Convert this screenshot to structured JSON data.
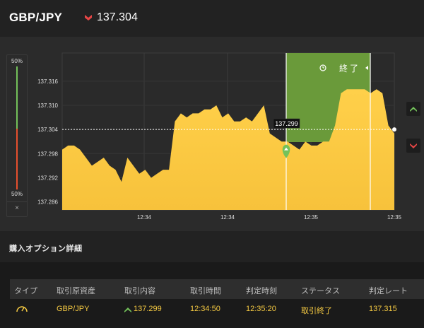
{
  "header": {
    "pair": "GBP/JPY",
    "price": "137.304",
    "trend_icon": "down-arrow-icon",
    "down_color": "#e84646",
    "up_color": "#74c25a",
    "accent_yellow": "#f3c842"
  },
  "sentiment_bar": {
    "top_label": "50%",
    "bottom_label": "50%",
    "up_percent": 50,
    "down_percent": 50,
    "close_label": "×"
  },
  "chart": {
    "overlay_label": "終了",
    "overlay_icon": "clock-icon",
    "current_price_tag": "137.299",
    "entry_marker_icon": "up-arrow-marker-icon",
    "side_buttons": [
      "up-arrow-icon",
      "down-arrow-icon"
    ]
  },
  "chart_data": {
    "type": "area",
    "y_ticks": [
      "137.316",
      "137.310",
      "137.304",
      "137.298",
      "137.292",
      "137.286"
    ],
    "x_ticks": [
      "12:34",
      "12:34",
      "12:35",
      "12:35"
    ],
    "current_price": 137.304,
    "entry_price": 137.299,
    "ylim": [
      137.284,
      137.323
    ],
    "series": [
      {
        "values": [
          137.299,
          137.3,
          137.3,
          137.299,
          137.297,
          137.295,
          137.296,
          137.297,
          137.295,
          137.294,
          137.291,
          137.297,
          137.295,
          137.293,
          137.294,
          137.292,
          137.293,
          137.294,
          137.294,
          137.306,
          137.308,
          137.307,
          137.308,
          137.308,
          137.309,
          137.309,
          137.31,
          137.307,
          137.308,
          137.306,
          137.306,
          137.307,
          137.306,
          137.308,
          137.31,
          137.303,
          137.302,
          137.301,
          137.301,
          137.3,
          137.299,
          137.301,
          137.3,
          137.3,
          137.301,
          137.301,
          137.305,
          137.313,
          137.314,
          137.314,
          137.314,
          137.314,
          137.313,
          137.314,
          137.313,
          137.305,
          137.303
        ]
      }
    ]
  },
  "details": {
    "title": "購入オプション詳細",
    "columns": [
      "タイプ",
      "取引原資産",
      "取引内容",
      "取引時間",
      "判定時刻",
      "ステータス",
      "判定レート"
    ],
    "row": {
      "type_icon": "speedometer-icon",
      "asset": "GBP/JPY",
      "direction_icon": "up-arrow-icon",
      "content": "137.299",
      "time": "12:34:50",
      "judge_time": "12:35:20",
      "status": "取引終了",
      "rate": "137.315"
    }
  }
}
